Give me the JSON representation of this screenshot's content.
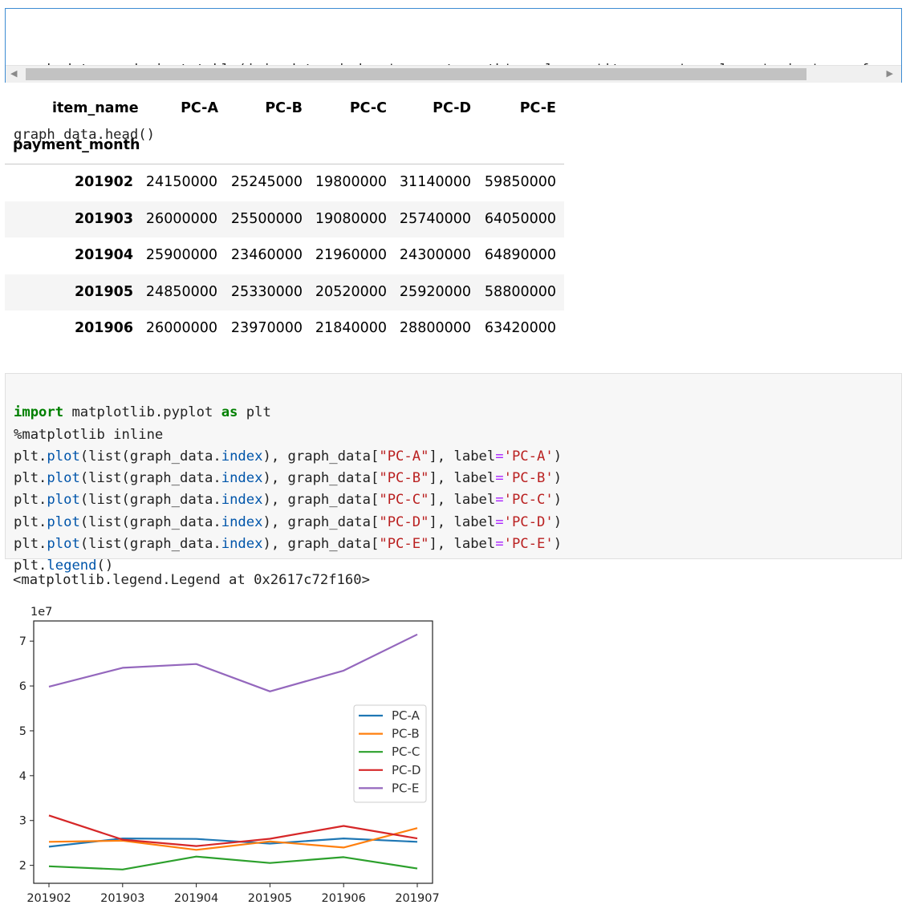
{
  "cell1": {
    "lines": [
      "graph_data = pd.pivot_table(join_data, index='payment_month', columns='item_name', values='price', aggfunc='sum')",
      "graph_data.head()"
    ]
  },
  "dataframe": {
    "columns_label": "item_name",
    "index_label": "payment_month",
    "columns": [
      "PC-A",
      "PC-B",
      "PC-C",
      "PC-D",
      "PC-E"
    ],
    "rows": [
      {
        "index": "201902",
        "values": [
          "24150000",
          "25245000",
          "19800000",
          "31140000",
          "59850000"
        ]
      },
      {
        "index": "201903",
        "values": [
          "26000000",
          "25500000",
          "19080000",
          "25740000",
          "64050000"
        ]
      },
      {
        "index": "201904",
        "values": [
          "25900000",
          "23460000",
          "21960000",
          "24300000",
          "64890000"
        ]
      },
      {
        "index": "201905",
        "values": [
          "24850000",
          "25330000",
          "20520000",
          "25920000",
          "58800000"
        ]
      },
      {
        "index": "201906",
        "values": [
          "26000000",
          "23970000",
          "21840000",
          "28800000",
          "63420000"
        ]
      }
    ]
  },
  "cell2": {
    "lines": [
      "import matplotlib.pyplot as plt",
      "%matplotlib inline",
      "plt.plot(list(graph_data.index), graph_data[\"PC-A\"], label='PC-A')",
      "plt.plot(list(graph_data.index), graph_data[\"PC-B\"], label='PC-B')",
      "plt.plot(list(graph_data.index), graph_data[\"PC-C\"], label='PC-C')",
      "plt.plot(list(graph_data.index), graph_data[\"PC-D\"], label='PC-D')",
      "plt.plot(list(graph_data.index), graph_data[\"PC-E\"], label='PC-E')",
      "plt.legend()"
    ]
  },
  "output_text": "<matplotlib.legend.Legend at 0x2617c72f160>",
  "chart_data": {
    "type": "line",
    "x": [
      "201902",
      "201903",
      "201904",
      "201905",
      "201906",
      "201907"
    ],
    "xticks": [
      "201902",
      "201903",
      "201904",
      "201905",
      "201906",
      "201907"
    ],
    "yticks": [
      "2",
      "3",
      "4",
      "5",
      "6",
      "7"
    ],
    "ylim": [
      1.6,
      7.45
    ],
    "offset_label": "1e7",
    "legend_position": "center-right",
    "grid": false,
    "series": [
      {
        "name": "PC-A",
        "color": "#1f77b4",
        "values": [
          2.415,
          2.6,
          2.59,
          2.485,
          2.6,
          2.525
        ]
      },
      {
        "name": "PC-B",
        "color": "#ff7f0e",
        "values": [
          2.5245,
          2.55,
          2.346,
          2.533,
          2.397,
          2.83
        ]
      },
      {
        "name": "PC-C",
        "color": "#2ca02c",
        "values": [
          1.98,
          1.908,
          2.196,
          2.052,
          2.184,
          1.93
        ]
      },
      {
        "name": "PC-D",
        "color": "#d62728",
        "values": [
          3.114,
          2.574,
          2.43,
          2.592,
          2.88,
          2.6
        ]
      },
      {
        "name": "PC-E",
        "color": "#9467bd",
        "values": [
          5.985,
          6.405,
          6.489,
          5.88,
          6.342,
          7.15
        ]
      }
    ]
  }
}
